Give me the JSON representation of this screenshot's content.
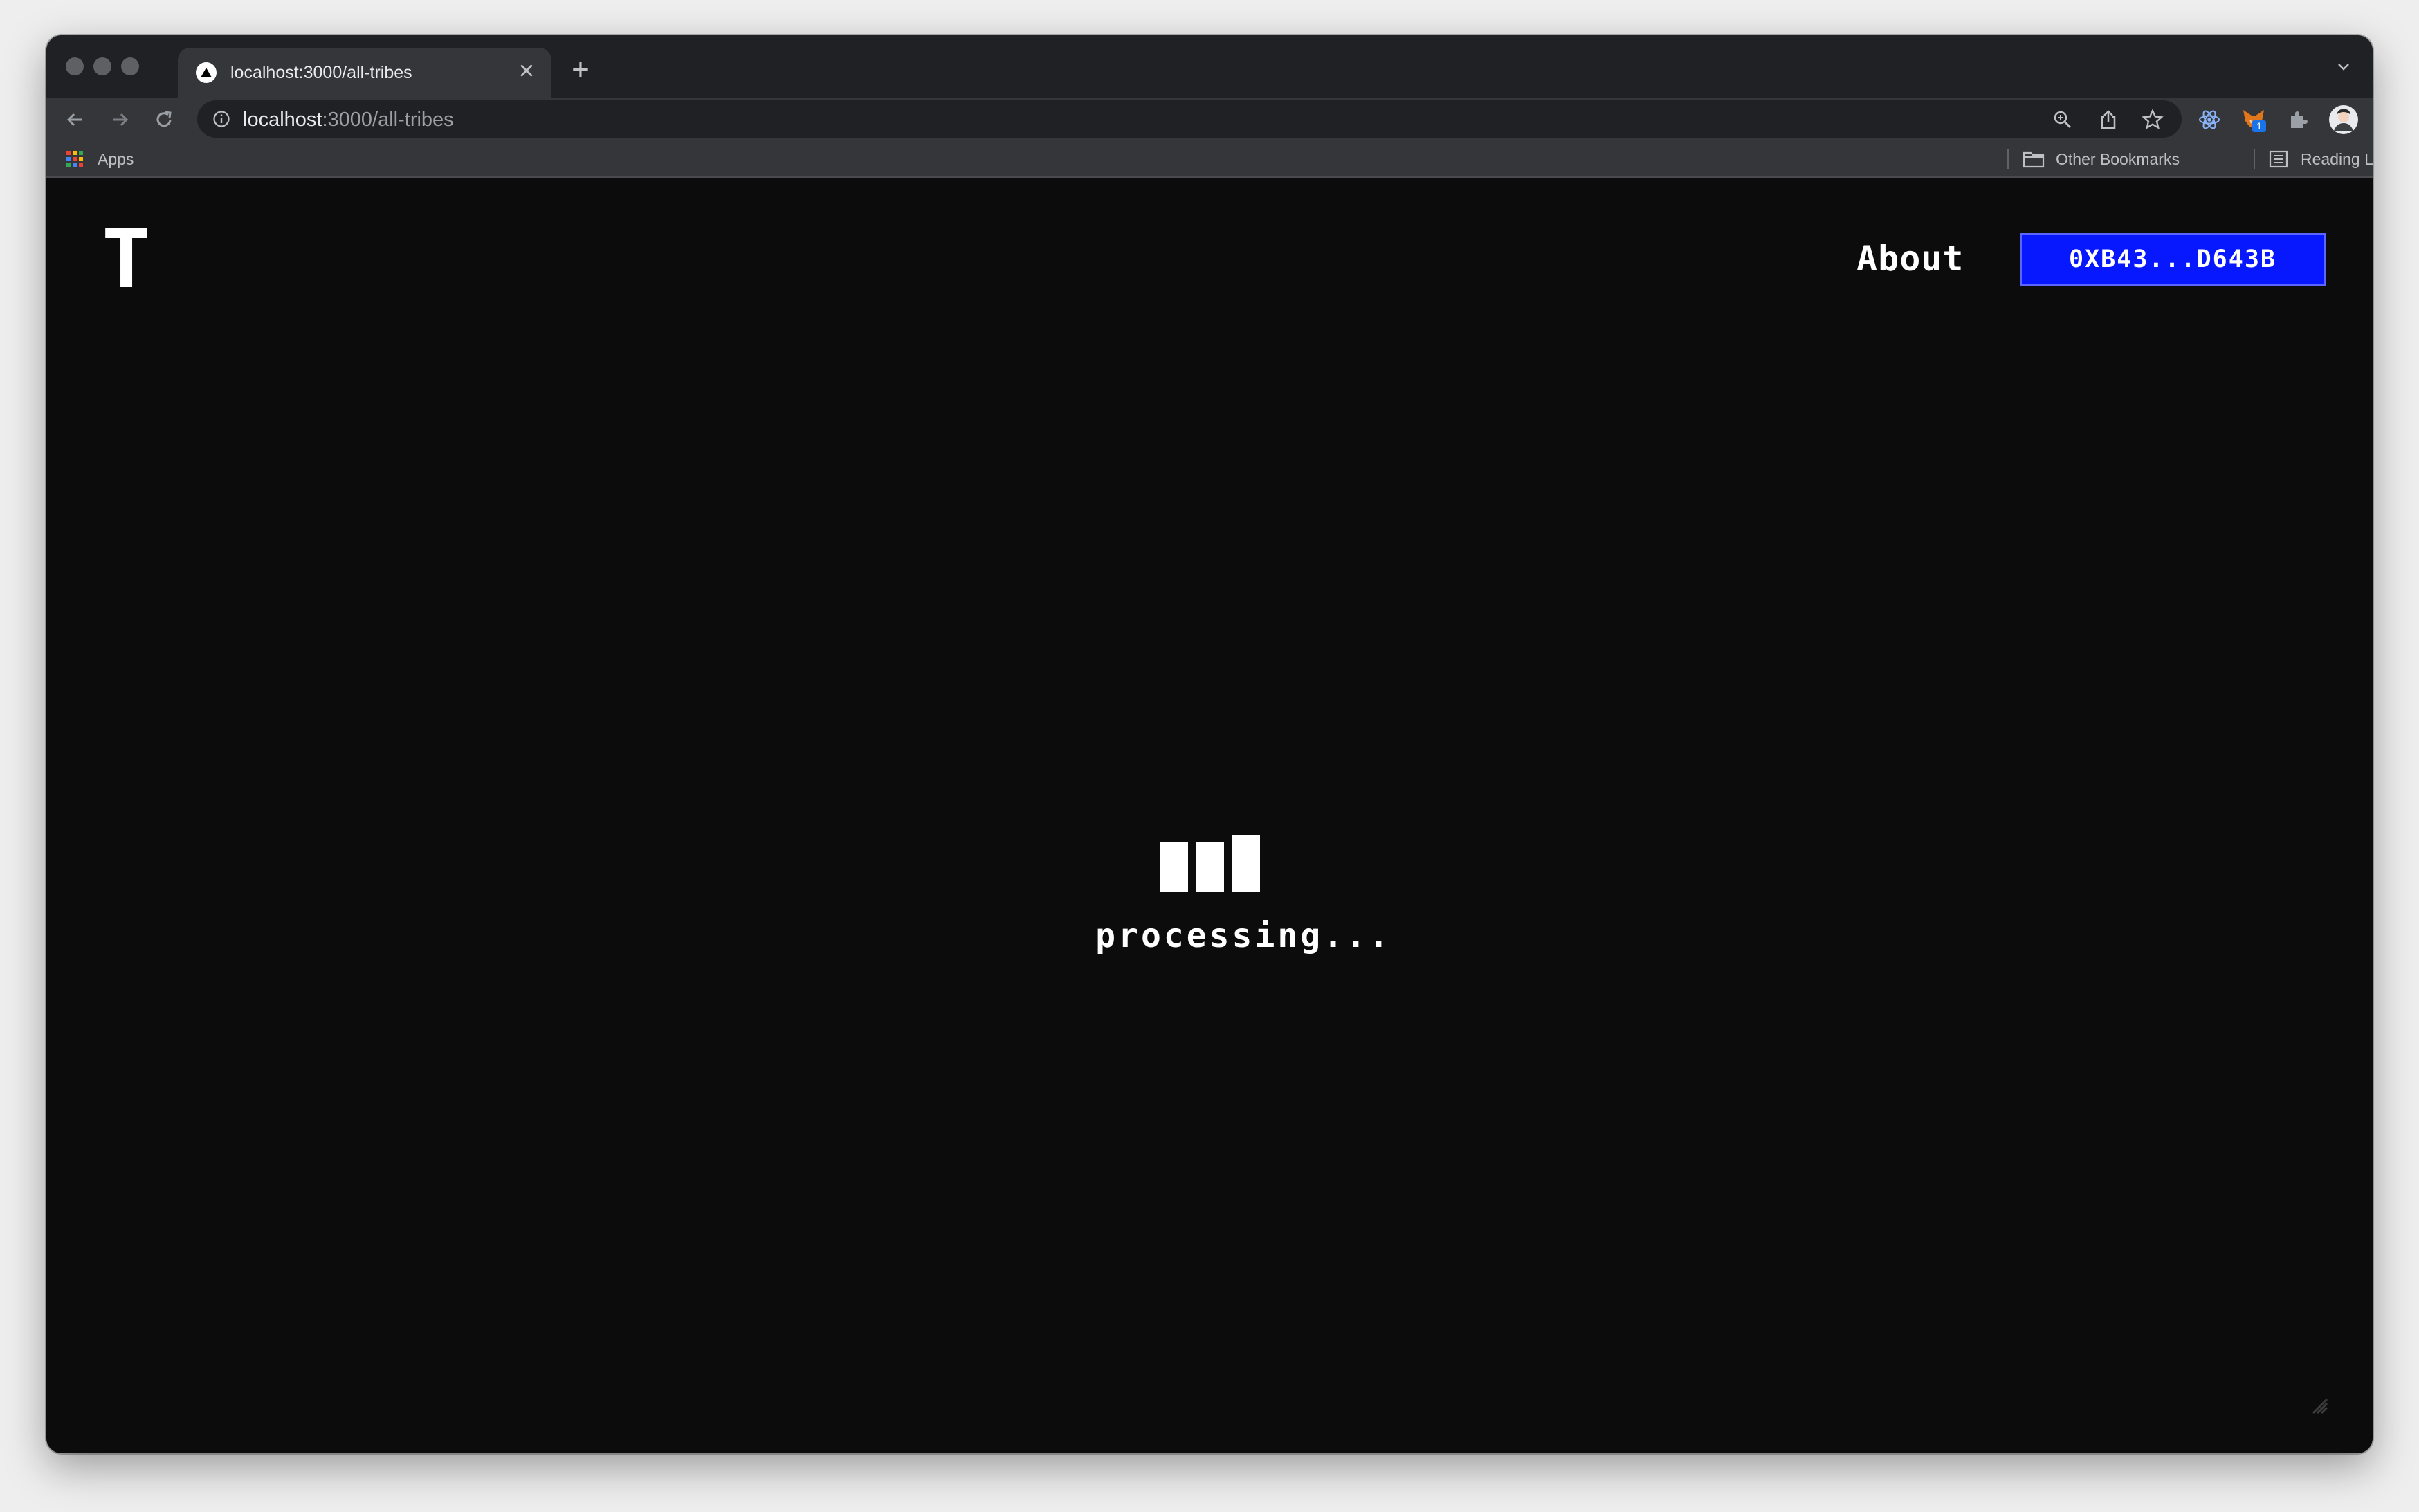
{
  "browser": {
    "tab": {
      "title": "localhost:3000/all-tribes",
      "close_glyph": "✕",
      "favicon": "triangle-icon"
    },
    "new_tab_glyph": "+",
    "address": {
      "host": "localhost",
      "path": ":3000/all-tribes"
    },
    "bookmarks": {
      "apps_label": "Apps",
      "other_label": "Other Bookmarks",
      "reading_label": "Reading List"
    },
    "extension_badge": "1"
  },
  "page": {
    "logo": "T",
    "nav": {
      "about_label": "About"
    },
    "wallet": {
      "address_label": "0XB43...D643B",
      "color": "#0718ff"
    },
    "loader": {
      "status_text": "processing..."
    }
  }
}
